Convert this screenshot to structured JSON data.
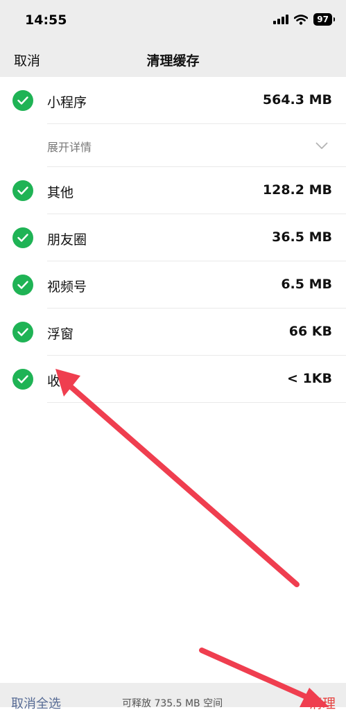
{
  "status": {
    "time": "14:55",
    "battery": "97"
  },
  "nav": {
    "cancel_label": "取消",
    "title": "清理缓存"
  },
  "items": [
    {
      "label": "小程序",
      "size": "564.3 MB"
    },
    {
      "label": "其他",
      "size": "128.2 MB"
    },
    {
      "label": "朋友圈",
      "size": "36.5 MB"
    },
    {
      "label": "视频号",
      "size": "6.5 MB"
    },
    {
      "label": "浮窗",
      "size": "66 KB"
    },
    {
      "label": "收藏",
      "size": "< 1KB"
    }
  ],
  "detail_label": "展开详情",
  "bottom": {
    "select_all_label": "取消全选",
    "free_space": "可释放 735.5 MB 空间",
    "clean_label": "清理"
  },
  "colors": {
    "check": "#1fb355",
    "link": "#576b95",
    "danger": "#e64340",
    "annotation_arrow": "#ef3e4f"
  }
}
